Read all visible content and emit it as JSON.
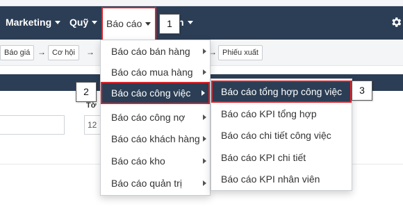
{
  "navbar": {
    "items": [
      {
        "label": "Marketing"
      },
      {
        "label": "Quỹ"
      },
      {
        "label": "Báo cáo"
      },
      {
        "label": "n"
      }
    ],
    "settings_icon": "gear-icon"
  },
  "breadcrumb": {
    "steps": [
      "Báo giá",
      "Cơ hội",
      "Phiếu xuất"
    ],
    "separator": "→"
  },
  "form": {
    "label_fragment": "Tờ",
    "input_value_fragment": "12"
  },
  "report_menu": {
    "items": [
      {
        "label": "Báo cáo bán hàng",
        "has_submenu": true
      },
      {
        "label": "Báo cáo mua hàng",
        "has_submenu": true
      },
      {
        "label": "Báo cáo công việc",
        "has_submenu": true,
        "active": true
      },
      {
        "label": "Báo cáo công nợ",
        "has_submenu": true
      },
      {
        "label": "Báo cáo khách hàng",
        "has_submenu": true
      },
      {
        "label": "Báo cáo kho",
        "has_submenu": true
      },
      {
        "label": "Báo cáo quản trị",
        "has_submenu": true
      }
    ]
  },
  "work_report_submenu": {
    "items": [
      {
        "label": "Báo cáo tổng hợp công việc",
        "active": true
      },
      {
        "label": "Báo cáo KPI tổng hợp"
      },
      {
        "label": "Báo cáo chi tiết công việc"
      },
      {
        "label": "Báo cáo KPI chi tiết"
      },
      {
        "label": "Báo cáo KPI nhân viên"
      }
    ]
  },
  "callouts": [
    "1",
    "2",
    "3"
  ],
  "colors": {
    "navbar_bg": "#2c3e55",
    "highlight_border": "#d9252c",
    "menu_active_bg": "#2c3e55"
  }
}
